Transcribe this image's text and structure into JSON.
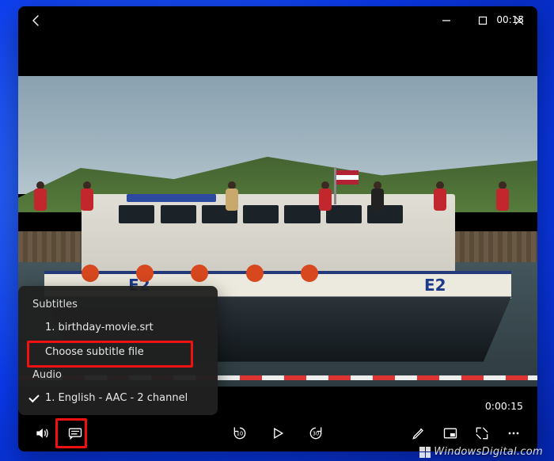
{
  "titlebar": {
    "duration": "00:15"
  },
  "menu": {
    "subtitles_heading": "Subtitles",
    "subtitle_item_1": "1. birthday-movie.srt",
    "choose_file": "Choose subtitle file",
    "audio_heading": "Audio",
    "audio_item_1": "1. English - AAC - 2 channel"
  },
  "controls": {
    "skip_back": "10",
    "skip_fwd": "30",
    "current_time": "0:00:15"
  },
  "scene": {
    "hull_text_left": "E2",
    "hull_text_right": "E2"
  },
  "watermark": "WindowsDigital.com"
}
